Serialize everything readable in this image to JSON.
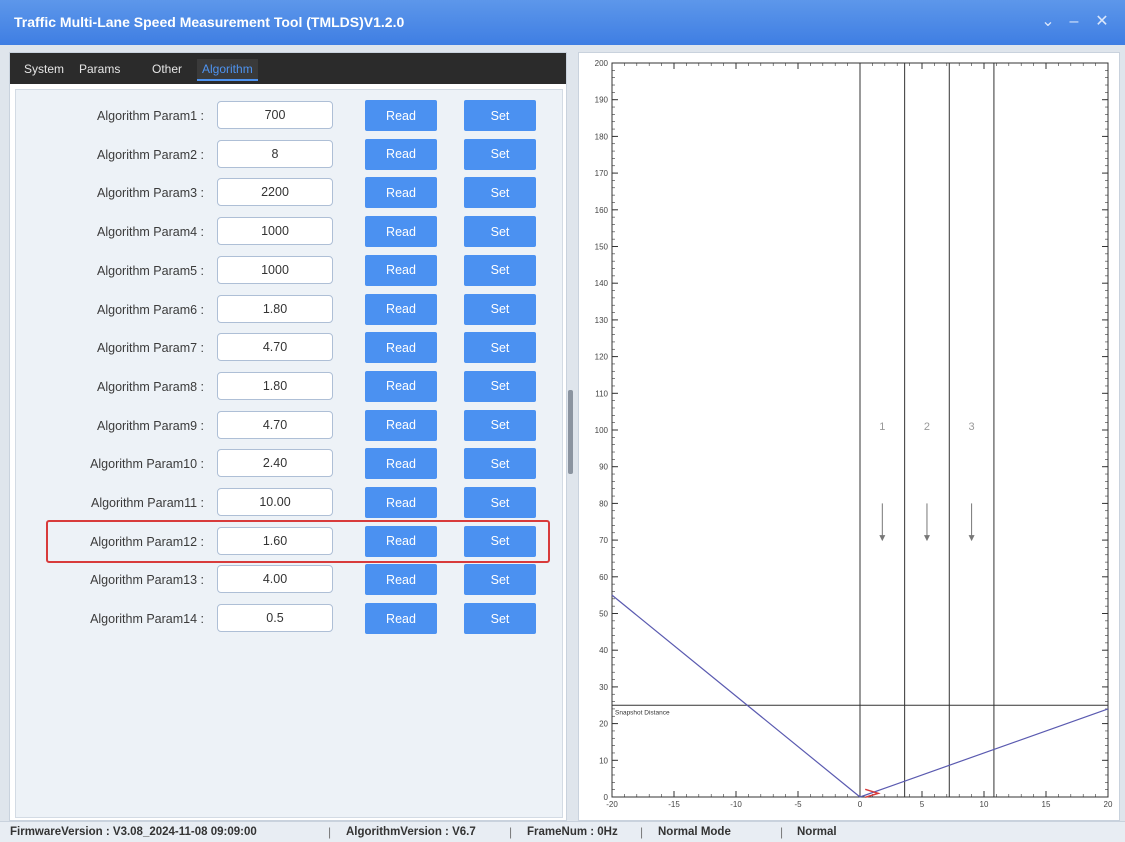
{
  "window": {
    "title": "Traffic Multi-Lane Speed Measurement Tool (TMLDS)V1.2.0",
    "controls": [
      "⌄",
      "–",
      "✕"
    ]
  },
  "tabs": [
    {
      "label": "System",
      "active": false
    },
    {
      "label": "Params",
      "active": false
    },
    {
      "label": "Other",
      "active": false
    },
    {
      "label": "Algorithm",
      "active": true
    }
  ],
  "params": [
    {
      "label": "Algorithm Param1 :",
      "value": "700"
    },
    {
      "label": "Algorithm Param2 :",
      "value": "8"
    },
    {
      "label": "Algorithm Param3 :",
      "value": "2200"
    },
    {
      "label": "Algorithm Param4 :",
      "value": "1000"
    },
    {
      "label": "Algorithm Param5 :",
      "value": "1000"
    },
    {
      "label": "Algorithm Param6 :",
      "value": "1.80"
    },
    {
      "label": "Algorithm Param7 :",
      "value": "4.70"
    },
    {
      "label": "Algorithm Param8 :",
      "value": "1.80"
    },
    {
      "label": "Algorithm Param9 :",
      "value": "4.70"
    },
    {
      "label": "Algorithm Param10 :",
      "value": "2.40"
    },
    {
      "label": "Algorithm Param11 :",
      "value": "10.00",
      "highlighted": true
    },
    {
      "label": "Algorithm Param12 :",
      "value": "1.60"
    },
    {
      "label": "Algorithm Param13 :",
      "value": "4.00"
    },
    {
      "label": "Algorithm Param14 :",
      "value": "0.5"
    }
  ],
  "buttons": {
    "read": "Read",
    "set": "Set"
  },
  "colors": {
    "accent": "#4b91f1",
    "highlight": "#d83b3b",
    "titlebar": "#3f7ee3",
    "lane_line": "#333333",
    "boundary_line": "#5a5ab0"
  },
  "chart_data": {
    "type": "line",
    "xlim": [
      -20,
      20
    ],
    "ylim": [
      0,
      200
    ],
    "xticks": [
      -20,
      -15,
      -10,
      -5,
      0,
      5,
      10,
      15,
      20
    ],
    "yticks": [
      0,
      10,
      20,
      30,
      40,
      50,
      60,
      70,
      80,
      90,
      100,
      110,
      120,
      130,
      140,
      150,
      160,
      170,
      180,
      190,
      200
    ],
    "lane_dividers_x": [
      0,
      3.6,
      7.2,
      10.8
    ],
    "lanes": [
      {
        "label": "1",
        "x": 1.8
      },
      {
        "label": "2",
        "x": 5.4
      },
      {
        "label": "3",
        "x": 9.0
      }
    ],
    "lane_direction": "down",
    "lane_label_y": 100,
    "arrow_y": [
      80,
      70
    ],
    "snapshot_distance": {
      "label": "Snapshot Distance",
      "y": 25
    },
    "boundary_lines": [
      {
        "points": [
          [
            -20,
            55
          ],
          [
            0,
            0
          ]
        ]
      },
      {
        "points": [
          [
            0,
            0
          ],
          [
            20,
            24
          ]
        ]
      }
    ],
    "origin_marker": {
      "x": 0.5,
      "y": 1
    }
  },
  "status": {
    "firmware": "FirmwareVersion : V3.08_2024-11-08 09:09:00",
    "algorithm": "AlgorithmVersion : V6.7",
    "frame": "FrameNum : 0Hz",
    "mode": "Normal Mode",
    "state": "Normal",
    "separator": "|"
  }
}
